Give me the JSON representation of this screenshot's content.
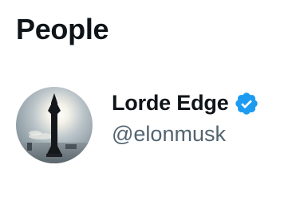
{
  "section": {
    "title": "People"
  },
  "person": {
    "display_name": "Lorde Edge",
    "handle": "@elonmusk",
    "verified": true,
    "verified_badge_icon": "verified-badge-icon",
    "avatar_icon": "rocket-avatar-image"
  },
  "colors": {
    "text_primary": "#0f1419",
    "text_secondary": "#536471",
    "verified_blue": "#1d9bf0",
    "background": "#ffffff"
  }
}
